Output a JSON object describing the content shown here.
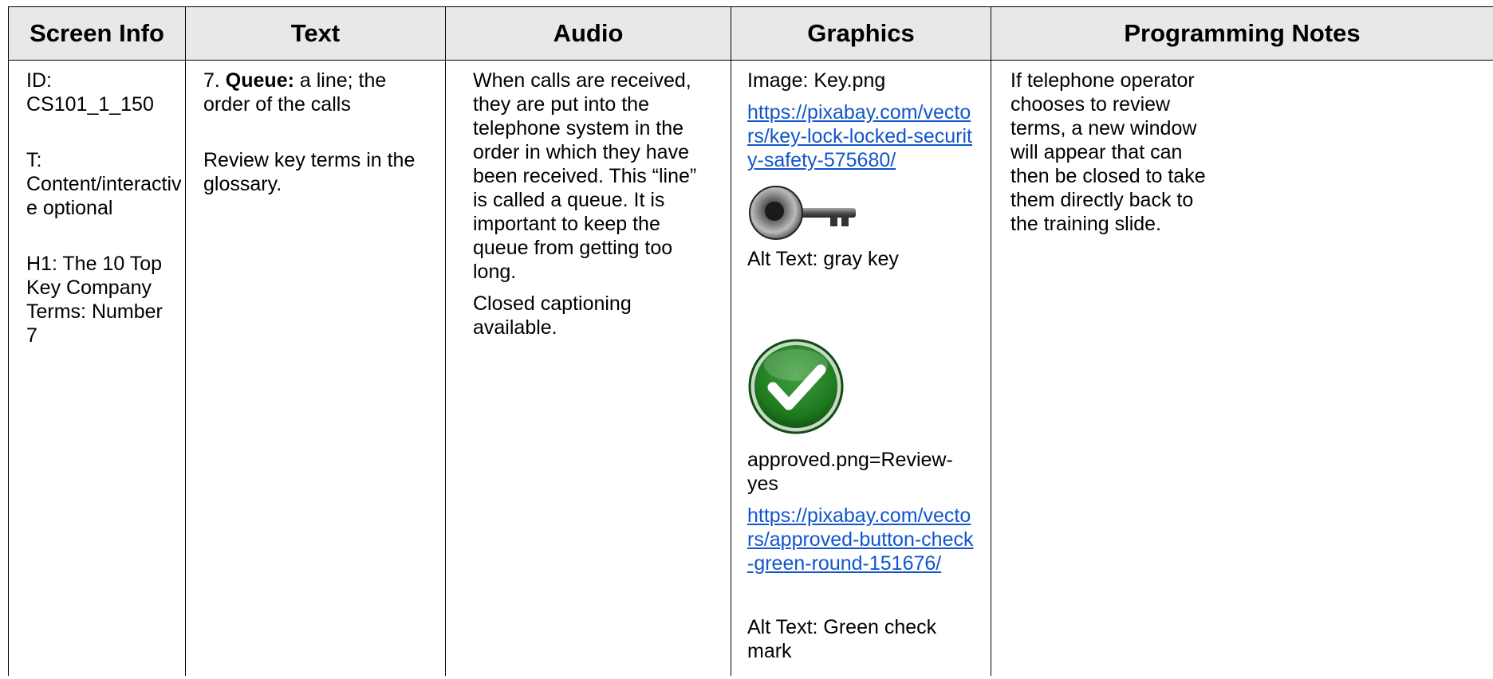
{
  "headers": {
    "screen_info": "Screen Info",
    "text": "Text",
    "audio": "Audio",
    "graphics": "Graphics",
    "programming_notes": "Programming Notes"
  },
  "screen_info": {
    "id_label": "ID:",
    "id_value": "CS101_1_150",
    "type_label": "T:",
    "type_value_1": "Content/interactiv",
    "type_value_2": "e optional",
    "h1_line_1": "H1: The 10 Top",
    "h1_line_2": "Key Company",
    "h1_line_3": "Terms: Number 7"
  },
  "text": {
    "term_number": "7. ",
    "term": "Queue:",
    "definition": " a line; the order of the calls",
    "review_note": "Review key terms in the glossary."
  },
  "audio": {
    "narration": "When calls are received, they are put into the telephone system in the order in which they have been received. This “line” is called a queue. It is important to keep the queue from getting too long.",
    "captions": "Closed captioning available."
  },
  "graphics": {
    "image_label": "Image: Key.png",
    "key_link": "https://pixabay.com/vectors/key-lock-locked-security-safety-575680/",
    "key_alt": "Alt Text: gray key",
    "approved_label": "approved.png=Review-yes",
    "approved_link": "https://pixabay.com/vectors/approved-button-check-green-round-151676/",
    "approved_alt": "Alt Text: Green check mark",
    "icons": [
      "key-icon",
      "check-mark-icon"
    ],
    "colors": {
      "link": "#1155cc",
      "check_green": "#1f7a1f",
      "key_gray": "#555555"
    }
  },
  "programming_notes": {
    "note": "If telephone operator chooses to review terms, a new window will appear that can then be closed to take them directly back to the training slide."
  },
  "colors": {
    "header_background": "#e8e8e8",
    "border": "#000000"
  }
}
